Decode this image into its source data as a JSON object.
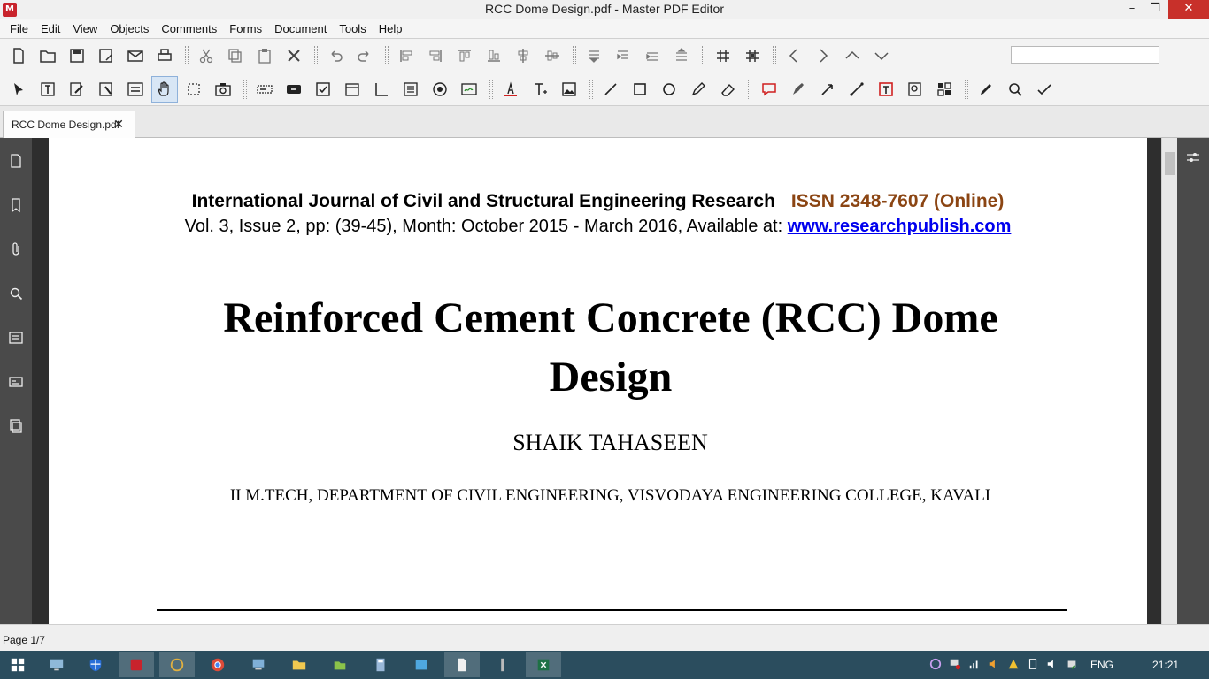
{
  "window": {
    "title": "RCC Dome Design.pdf - Master PDF Editor",
    "minimize": "–",
    "restore": "❐",
    "close": "✕"
  },
  "menu": [
    "File",
    "Edit",
    "View",
    "Objects",
    "Comments",
    "Forms",
    "Document",
    "Tools",
    "Help"
  ],
  "tab": {
    "label": "RCC Dome Design.pdf",
    "close": "✕"
  },
  "page": {
    "journal": "International Journal of Civil and Structural Engineering Research",
    "issn": "ISSN 2348-7607 (Online)",
    "volume": "Vol. 3, Issue 2, pp: (39-45), Month: October 2015 - March 2016, Available at: ",
    "link": "www.researchpublish.com",
    "title": "Reinforced Cement Concrete (RCC) Dome Design",
    "author": "SHAIK TAHASEEN",
    "affiliation": "II M.TECH, DEPARTMENT OF CIVIL ENGINEERING, VISVODAYA ENGINEERING COLLEGE, KAVALI"
  },
  "status": {
    "page": "Page 1/7"
  },
  "tray": {
    "language": "ENG",
    "time": "21:21"
  },
  "colors": {
    "accent": "#c8232c",
    "link": "#0000ee",
    "issn": "#8b4513",
    "taskbar": "#2b4d5e"
  }
}
